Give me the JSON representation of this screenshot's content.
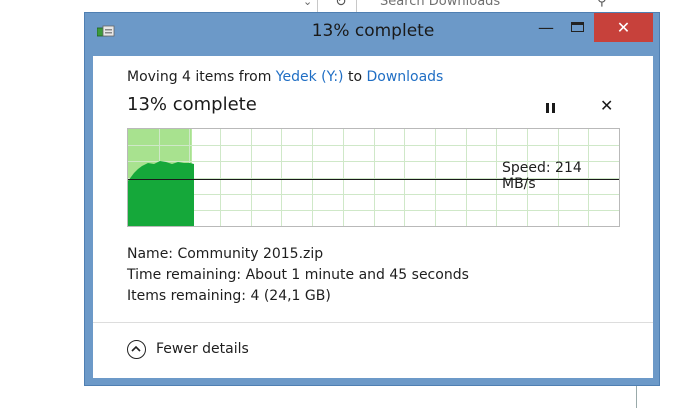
{
  "background": {
    "search_placeholder": "Search Downloads",
    "icons": [
      "chevron-down-icon",
      "refresh-icon",
      "search-icon"
    ]
  },
  "dialog": {
    "title": "13% complete",
    "window_buttons": {
      "minimize": "—",
      "close": "✕"
    },
    "moving": {
      "prefix": "Moving 4 items from ",
      "source": "Yedek (Y:)",
      "middle": " to ",
      "destination": "Downloads"
    },
    "status_heading": "13% complete",
    "progress_percent": 13,
    "speed_label": "Speed: 214 MB/s",
    "details": {
      "name": "Name:  Community 2015.zip",
      "time_remaining": "Time remaining:  About 1 minute and 45 seconds",
      "items_remaining": "Items remaining:  4 (24,1 GB)"
    },
    "fewer_details": "Fewer details",
    "colors": {
      "frame": "#6c99c8",
      "close": "#c7413b",
      "graph_progress": "#a8e28f",
      "graph_fill": "#15a83a",
      "link": "#1f6ec4"
    }
  }
}
